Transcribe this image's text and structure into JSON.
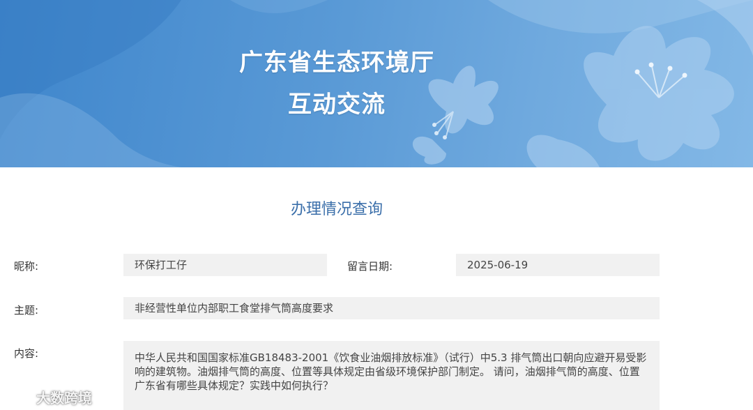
{
  "banner": {
    "line1": "广东省生态环境厅",
    "line2": "互动交流"
  },
  "section": {
    "title": "办理情况查询"
  },
  "form": {
    "nickname_label": "昵称:",
    "nickname_value": "环保打工仔",
    "date_label": "留言日期:",
    "date_value": "2025-06-19",
    "subject_label": "主题:",
    "subject_value": "非经营性单位内部职工食堂排气筒高度要求",
    "content_label": "内容:",
    "content_value": "中华人民共和国国家标准GB18483-2001《饮食业油烟排放标准》（试行）中5.3 排气筒出口朝向应避开易受影响的建筑物。油烟排气筒的高度、位置等具体规定由省级环境保护部门制定。 请问，油烟排气筒的高度、位置广东省有哪些具体规定？实践中如何执行？"
  },
  "watermark": {
    "text": "大数跨境",
    "icon": "brand-logo-icon"
  },
  "colors": {
    "banner_blue": "#4a8fd0",
    "title_blue": "#3b6faa",
    "field_bg": "#f1f1f1"
  }
}
